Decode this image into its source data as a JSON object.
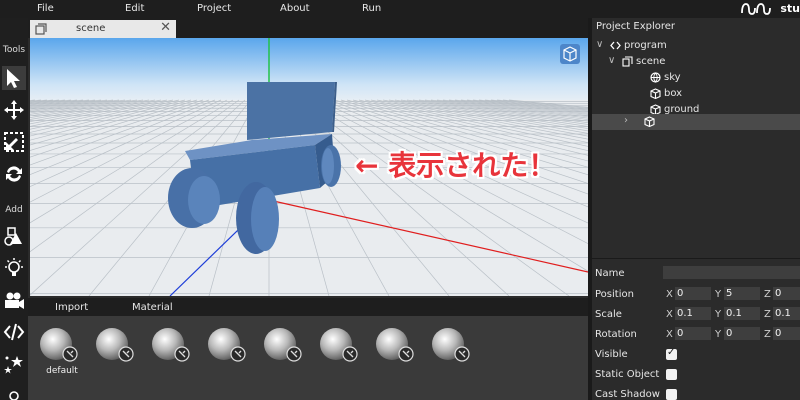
{
  "menubar": {
    "items": [
      "File",
      "Edit",
      "Project",
      "About",
      "Run"
    ],
    "logo_text": "stu"
  },
  "toolbar": {
    "tools_label": "Tools",
    "add_label": "Add",
    "tools": [
      "select-arrow-icon",
      "move-icon",
      "scale-icon",
      "rotate-icon"
    ],
    "add_items": [
      "primitive-shape-icon",
      "light-bulb-icon",
      "camera-icon",
      "script-icon",
      "particles-icon"
    ]
  },
  "tab": {
    "label": "scene",
    "close": "✕"
  },
  "viewport": {
    "view_toggle_icon": "cube-icon",
    "accent": "#4d86c9"
  },
  "annotation": {
    "text": "← 表示された！",
    "color": "#e8343b"
  },
  "assets": {
    "tabs": [
      "Import",
      "Material"
    ],
    "items": [
      {
        "label": "default"
      },
      {
        "label": ""
      },
      {
        "label": ""
      },
      {
        "label": ""
      },
      {
        "label": ""
      },
      {
        "label": ""
      },
      {
        "label": ""
      },
      {
        "label": ""
      }
    ]
  },
  "explorer": {
    "title": "Project Explorer",
    "tree": [
      {
        "label": "program",
        "icon": "code-icon",
        "chevron": "∨"
      },
      {
        "label": "scene",
        "icon": "scene-icon",
        "chevron": "∨"
      },
      {
        "label": "sky",
        "icon": "sky-icon",
        "chevron": ""
      },
      {
        "label": "box",
        "icon": "box-icon",
        "chevron": ""
      },
      {
        "label": "ground",
        "icon": "box-icon",
        "chevron": ""
      },
      {
        "label": "",
        "icon": "box-icon",
        "chevron": "›"
      }
    ]
  },
  "properties": {
    "name_label": "Name",
    "name_value": "",
    "position_label": "Position",
    "position": {
      "x": "0",
      "y": "5",
      "z": "0"
    },
    "scale_label": "Scale",
    "scale": {
      "x": "0.1",
      "y": "0.1",
      "z": "0.1"
    },
    "rotation_label": "Rotation",
    "rotation": {
      "x": "0",
      "y": "0",
      "z": "0"
    },
    "axis_x": "X",
    "axis_y": "Y",
    "axis_z": "Z",
    "visible_label": "Visible",
    "visible": true,
    "static_label": "Static Object",
    "static": false,
    "shadow_label": "Cast Shadow",
    "shadow": false
  }
}
